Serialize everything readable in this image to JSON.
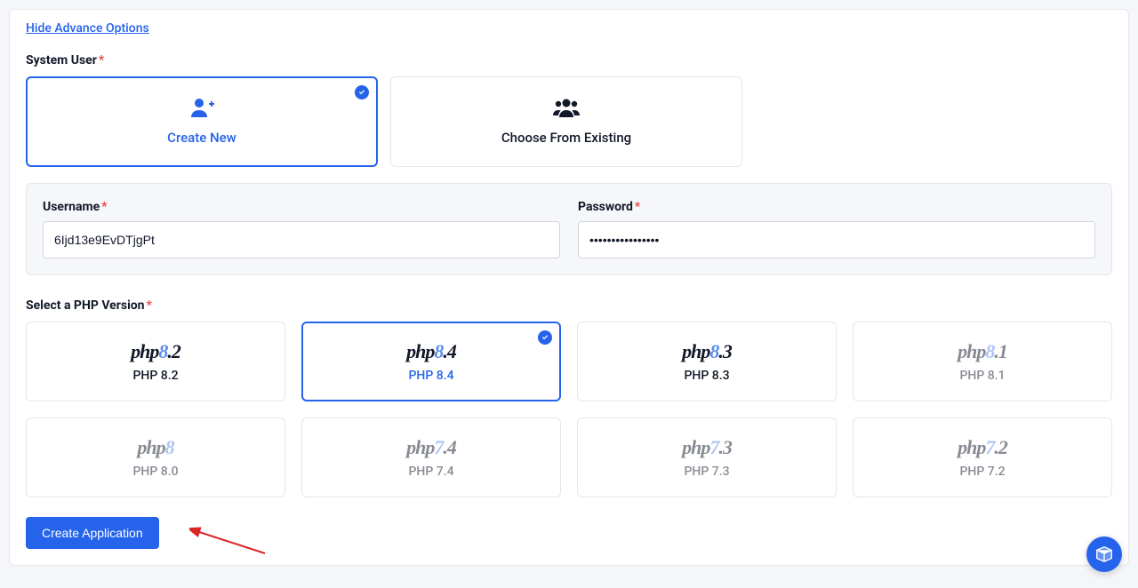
{
  "toggleLink": "Hide Advance Options",
  "systemUser": {
    "label": "System User",
    "options": [
      {
        "label": "Create New",
        "selected": true
      },
      {
        "label": "Choose From Existing",
        "selected": false
      }
    ]
  },
  "credentials": {
    "usernameLabel": "Username",
    "usernameValue": "6Ijd13e9EvDTjgPt",
    "passwordLabel": "Password",
    "passwordValue": "••••••••••••••••"
  },
  "phpSection": {
    "label": "Select a PHP Version",
    "versions": [
      {
        "logoMain": "php",
        "logoAccent": "8",
        "logoSuffix": ".2",
        "text": "PHP 8.2",
        "selected": false,
        "disabled": false
      },
      {
        "logoMain": "php",
        "logoAccent": "8",
        "logoSuffix": ".4",
        "text": "PHP 8.4",
        "selected": true,
        "disabled": false
      },
      {
        "logoMain": "php",
        "logoAccent": "8",
        "logoSuffix": ".3",
        "text": "PHP 8.3",
        "selected": false,
        "disabled": false
      },
      {
        "logoMain": "php",
        "logoAccent": "8",
        "logoSuffix": ".1",
        "text": "PHP 8.1",
        "selected": false,
        "disabled": true
      },
      {
        "logoMain": "php",
        "logoAccent": "8",
        "logoSuffix": "",
        "text": "PHP 8.0",
        "selected": false,
        "disabled": true
      },
      {
        "logoMain": "php",
        "logoAccent": "7",
        "logoSuffix": ".4",
        "text": "PHP 7.4",
        "selected": false,
        "disabled": true
      },
      {
        "logoMain": "php",
        "logoAccent": "7",
        "logoSuffix": ".3",
        "text": "PHP 7.3",
        "selected": false,
        "disabled": true
      },
      {
        "logoMain": "php",
        "logoAccent": "7",
        "logoSuffix": ".2",
        "text": "PHP 7.2",
        "selected": false,
        "disabled": true
      }
    ]
  },
  "createButton": "Create Application"
}
